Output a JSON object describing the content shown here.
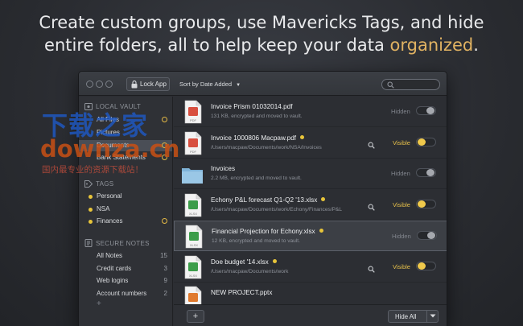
{
  "headline": {
    "line1": "Create custom groups, use Mavericks Tags, and hide",
    "line2_prefix": "entire folders, all to help keep your data ",
    "line2_accent": "organized",
    "line2_suffix": "."
  },
  "colors": {
    "accent": "#e0b262",
    "tag_yellow": "#e8c53a",
    "visible_label": "#e7c04a"
  },
  "toolbar": {
    "lock_label": "Lock App",
    "sort_label": "Sort by Date Added",
    "search_placeholder": ""
  },
  "sidebar": {
    "local_vault": {
      "heading": "LOCAL VAULT",
      "items": [
        {
          "label": "All Files",
          "ring": true
        },
        {
          "label": "Pictures",
          "ring": false
        },
        {
          "label": "Documents",
          "ring": true,
          "selected": true
        },
        {
          "label": "Bank Statements",
          "ring": true
        }
      ]
    },
    "tags": {
      "heading": "TAGS",
      "items": [
        {
          "label": "Personal",
          "ring": false
        },
        {
          "label": "NSA",
          "ring": false
        },
        {
          "label": "Finances",
          "ring": true
        }
      ]
    },
    "secure_notes": {
      "heading": "SECURE NOTES",
      "items": [
        {
          "label": "All Notes",
          "count": "15"
        },
        {
          "label": "Credit cards",
          "count": "3"
        },
        {
          "label": "Web logins",
          "count": "9"
        },
        {
          "label": "Account numbers",
          "count": "2"
        }
      ],
      "add_label": "+"
    }
  },
  "files": [
    {
      "name": "Invoice Prism 01032014.pdf",
      "meta": "131 KB, encrypted and moved to vault.",
      "icon": "pdf-file-icon",
      "tag": false,
      "state": "Hidden",
      "on": false,
      "quicklook": false
    },
    {
      "name": "Invoice 1000806 Macpaw.pdf",
      "meta": "/Users/macpaw/Documents/work/NSA/Invoices",
      "icon": "pdf-file-icon",
      "tag": true,
      "state": "Visible",
      "on": true,
      "quicklook": true
    },
    {
      "name": "Invoices",
      "meta": "2.2 MB, encrypted and moved to vault.",
      "icon": "folder-icon",
      "tag": false,
      "state": "Hidden",
      "on": false,
      "quicklook": false
    },
    {
      "name": "Echony P&L forecast Q1-Q2 '13.xlsx",
      "meta": "/Users/macpaw/Documents/work/Echony/Finances/P&L",
      "icon": "xlsx-file-icon",
      "tag": true,
      "state": "Visible",
      "on": true,
      "quicklook": true
    },
    {
      "name": "Financial Projection for Echony.xlsx",
      "meta": "12 KB, encrypted and moved to vault.",
      "icon": "xlsx-file-icon",
      "tag": true,
      "state": "Hidden",
      "on": false,
      "quicklook": false,
      "selected": true
    },
    {
      "name": "Doe budget '14.xlsx",
      "meta": "/Users/macpaw/Documents/work",
      "icon": "xlsx-file-icon",
      "tag": true,
      "state": "Visible",
      "on": true,
      "quicklook": true
    },
    {
      "name": "NEW PROJECT.pptx",
      "meta": "",
      "icon": "pptx-file-icon",
      "tag": false,
      "state": "",
      "on": false,
      "quicklook": false
    }
  ],
  "bottombar": {
    "add_label": "+",
    "hide_all_label": "Hide All"
  },
  "watermark": {
    "line1": "下载之家",
    "line2": "downza.cn",
    "line3": "国内最专业的资源下载站！"
  }
}
